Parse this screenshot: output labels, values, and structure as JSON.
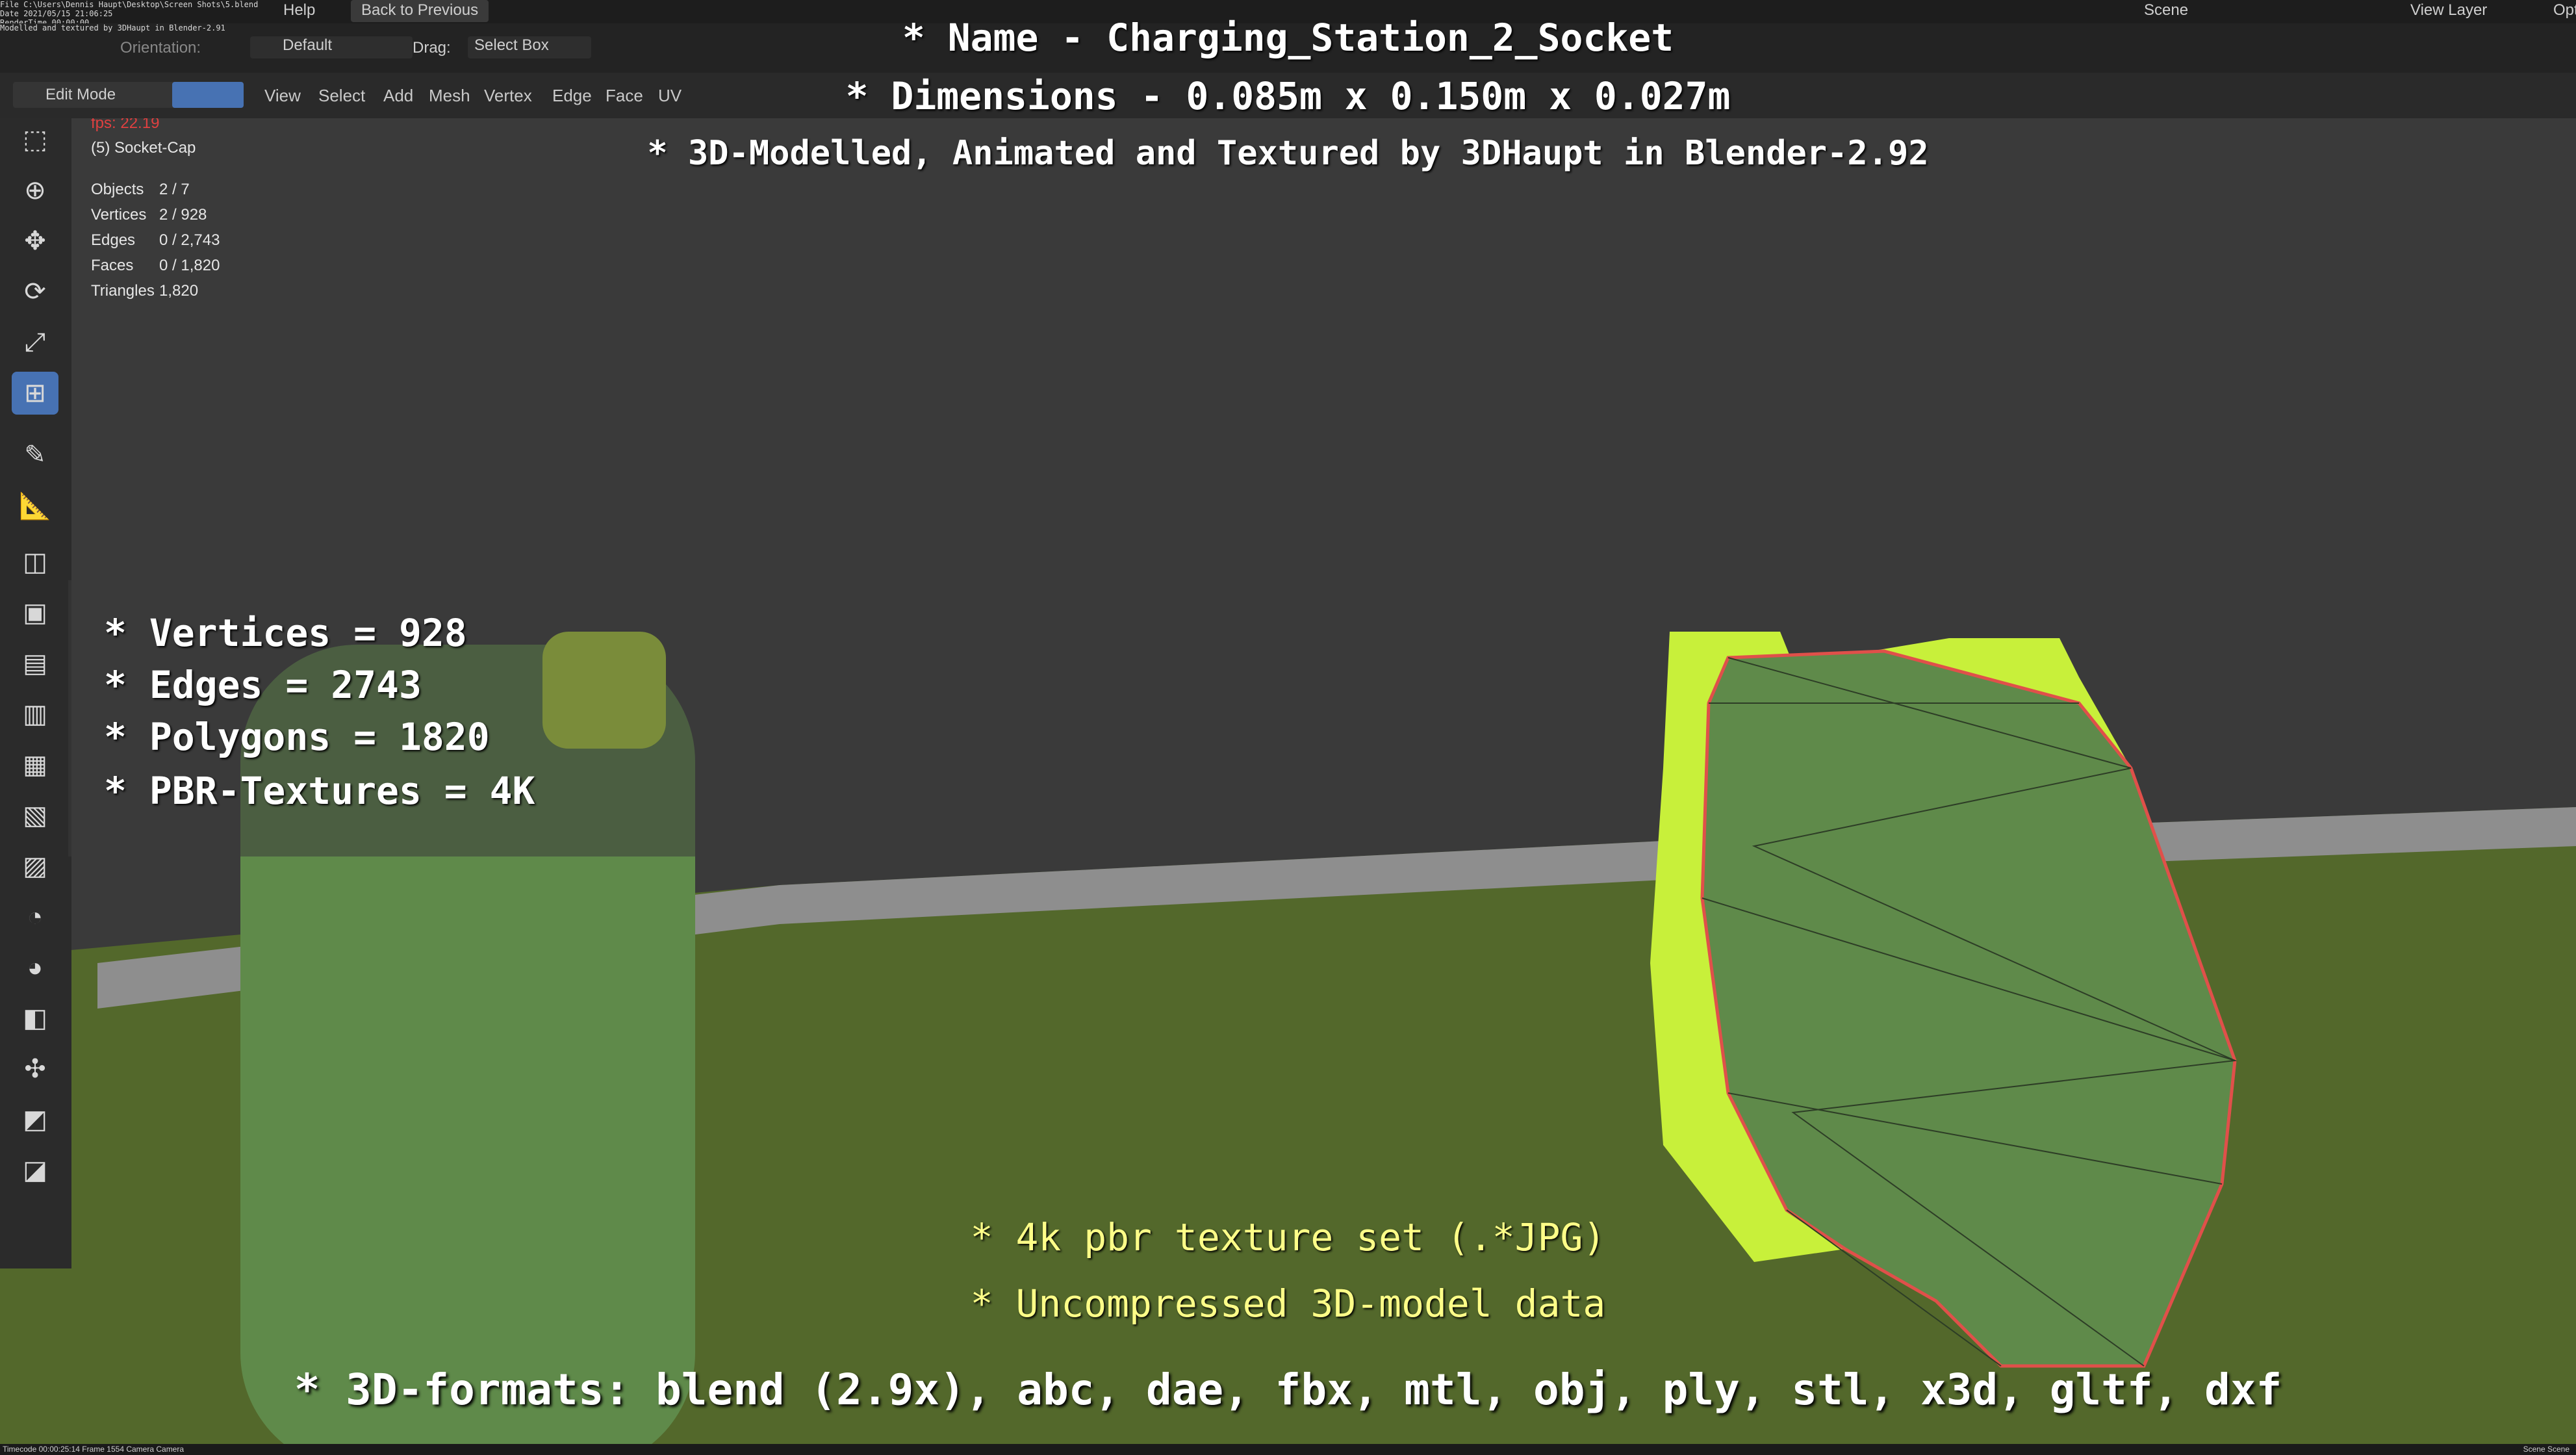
{
  "top_info": {
    "lines": [
      "File C:\\Users\\Dennis Haupt\\Desktop\\Screen Shots\\5.blend",
      "Date 2021/05/15 21:06:25",
      "RenderTime 00:00:00",
      "Modelled and textured by 3DHaupt in Blender-2.91"
    ]
  },
  "menubar": {
    "items": [
      "Help",
      "Back to Previous"
    ],
    "scene": "Scene",
    "view_layer": "View Layer",
    "options": "Opti"
  },
  "header2": {
    "orientation_label": "Orientation:",
    "orientation_value": "Default",
    "drag_label": "Drag:",
    "drag_value": "Select Box"
  },
  "header3": {
    "mode": "Edit Mode",
    "menus": [
      "View",
      "Select",
      "Add",
      "Mesh",
      "Vertex",
      "Edge",
      "Face",
      "UV"
    ]
  },
  "viewport_info": {
    "fps": "fps: 22.19",
    "object": "(5) Socket-Cap",
    "stats": [
      {
        "label": "Objects",
        "value": "2 / 7"
      },
      {
        "label": "Vertices",
        "value": "2 / 928"
      },
      {
        "label": "Edges",
        "value": "0 / 2,743"
      },
      {
        "label": "Faces",
        "value": "0 / 1,820"
      },
      {
        "label": "Triangles",
        "value": "1,820"
      }
    ]
  },
  "overlay": {
    "name_line": "* Name - Charging_Station_2_Socket",
    "dimensions_line": "* Dimensions -  0.085m x 0.150m x 0.027m",
    "credit_line": "* 3D-Modelled, Animated and Textured by 3DHaupt in Blender-2.92",
    "stats": [
      "* Vertices = 928",
      "* Edges = 2743",
      "* Polygons = 1820",
      "* PBR-Textures = 4K"
    ],
    "texture_line": "* 4k pbr texture set (.*JPG)",
    "uncompressed_line": "* Uncompressed 3D-model data",
    "formats_line": "* 3D-formats: blend (2.9x), abc, dae, fbx, mtl, obj, ply, stl, x3d, gltf, dxf"
  },
  "footer": {
    "left": "Timecode 00:00:25:14   Frame 1554   Camera Camera",
    "right": "Scene Scene"
  },
  "colors": {
    "accent": "#4772b3",
    "mesh_green": "#5f8a4a",
    "mesh_yellow": "#c8f03a",
    "edge_red": "#e0504a"
  },
  "icons": [
    "select-box-icon",
    "cursor-icon",
    "move-icon",
    "rotate-icon",
    "scale-icon",
    "transform-icon",
    "annotate-icon",
    "measure-icon",
    "add-cube-icon",
    "extrude-icon",
    "inset-icon",
    "bevel-icon",
    "loopcut-icon",
    "knife-icon",
    "polybuild-icon",
    "spin-icon",
    "smooth-icon",
    "edge-slide-icon",
    "shrink-icon",
    "shear-icon",
    "rip-icon"
  ]
}
